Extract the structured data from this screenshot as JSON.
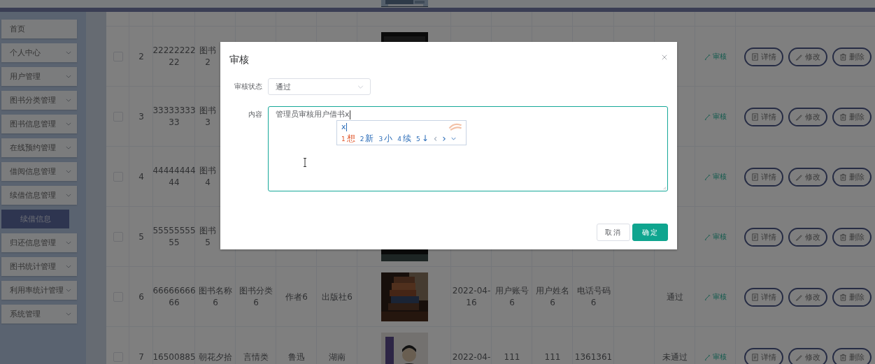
{
  "header": {
    "cover": {
      "kind": "picture"
    }
  },
  "sidebar": {
    "items": [
      {
        "label": "首页",
        "kind": "link",
        "selected": false
      },
      {
        "label": "个人中心",
        "kind": "submenu",
        "selected": false
      },
      {
        "label": "用户管理",
        "kind": "submenu",
        "selected": false
      },
      {
        "label": "图书分类管理",
        "kind": "submenu",
        "selected": false
      },
      {
        "label": "图书信息管理",
        "kind": "submenu",
        "selected": false
      },
      {
        "label": "在线预约管理",
        "kind": "submenu",
        "selected": false
      },
      {
        "label": "借阅信息管理",
        "kind": "submenu",
        "selected": false
      },
      {
        "label": "续借信息管理",
        "kind": "submenu",
        "selected": false,
        "children": [
          {
            "label": "续借信息",
            "selected": true
          }
        ]
      },
      {
        "label": "归还信息管理",
        "kind": "submenu",
        "selected": false
      },
      {
        "label": "图书统计管理",
        "kind": "submenu",
        "selected": false
      },
      {
        "label": "利用率统计管理",
        "kind": "submenu",
        "selected": false
      },
      {
        "label": "系统管理",
        "kind": "submenu",
        "selected": false
      }
    ]
  },
  "table": {
    "rows": [
      {
        "cells": [
          null,
          null,
          null,
          null,
          null,
          null,
          null,
          null,
          null,
          null,
          null,
          null,
          null
        ]
      },
      {
        "checked": false,
        "cells": [
          "2",
          "22222222\n22",
          "图书\n2",
          null,
          null,
          null,
          {
            "kind": "picture"
          },
          null,
          null,
          null,
          null,
          null,
          null
        ],
        "review_link": "审核",
        "actions": [
          {
            "kind": "detail",
            "label": "详情"
          },
          {
            "kind": "edit",
            "label": "修改"
          },
          {
            "kind": "delete",
            "label": "删除"
          }
        ]
      },
      {
        "checked": false,
        "cells": [
          "3",
          "33333333\n33",
          "图书\n3",
          null,
          null,
          null,
          null,
          null,
          null,
          null,
          null,
          null,
          null
        ],
        "review_link": "审核",
        "actions": [
          {
            "kind": "detail",
            "label": "详情"
          },
          {
            "kind": "edit",
            "label": "修改"
          },
          {
            "kind": "delete",
            "label": "删除"
          }
        ]
      },
      {
        "checked": false,
        "cells": [
          "4",
          "44444444\n44",
          "图书\n4",
          null,
          null,
          null,
          null,
          null,
          null,
          null,
          null,
          null,
          null
        ],
        "review_link": "审核",
        "actions": [
          {
            "kind": "detail",
            "label": "详情"
          },
          {
            "kind": "edit",
            "label": "修改"
          },
          {
            "kind": "delete",
            "label": "删除"
          }
        ]
      },
      {
        "checked": false,
        "cells": [
          "5",
          "55555555\n55",
          "图书\n5",
          null,
          null,
          null,
          {
            "kind": "picture"
          },
          null,
          null,
          null,
          null,
          null,
          null
        ],
        "review_link": "审核",
        "actions": [
          {
            "kind": "detail",
            "label": "详情"
          },
          {
            "kind": "edit",
            "label": "修改"
          },
          {
            "kind": "delete",
            "label": "删除"
          }
        ]
      },
      {
        "checked": false,
        "cells": [
          "6",
          "66666666\n66",
          "图书名称\n6",
          "图书分类\n6",
          "作者6",
          "出版社6",
          {
            "kind": "picture"
          },
          "2022-04-\n16",
          "用户账号\n6",
          "用户姓名\n6",
          "电话号码\n6",
          null,
          "通过"
        ],
        "review_link": "审核",
        "actions": [
          {
            "kind": "detail",
            "label": "详情"
          },
          {
            "kind": "edit",
            "label": "修改"
          },
          {
            "kind": "delete",
            "label": "删除"
          }
        ]
      },
      {
        "checked": false,
        "cells": [
          "7",
          "16500885",
          "朝花夕拾",
          "言情类",
          "鲁迅",
          "湖南",
          {
            "kind": "picture"
          },
          "2022-04-",
          "111",
          "111",
          "1361361",
          null,
          "未通过"
        ],
        "review_link": "审核",
        "actions": [
          {
            "kind": "detail",
            "label": "详情"
          },
          {
            "kind": "edit",
            "label": "修改"
          },
          {
            "kind": "delete",
            "label": "删除"
          }
        ]
      }
    ]
  },
  "dialog": {
    "title": "审核",
    "fields": [
      {
        "kind": "select",
        "label": "审核状态",
        "value": "通过"
      },
      {
        "kind": "textarea",
        "label": "内容",
        "value": "管理员审核用户借书x"
      }
    ],
    "ime": {
      "composition": "x",
      "candidates": [
        {
          "number": "1",
          "text": "想",
          "selected": true
        },
        {
          "number": "2",
          "text": "新",
          "selected": false
        },
        {
          "number": "3",
          "text": "小",
          "selected": false
        },
        {
          "number": "4",
          "text": "续",
          "selected": false
        },
        {
          "number": "5",
          "text": "↓",
          "selected": false
        }
      ],
      "prev": {
        "text": "‹",
        "disabled": true
      },
      "next": {
        "text": "›",
        "disabled": false
      }
    },
    "buttons": [
      {
        "kind": "secondary",
        "label": "取消"
      },
      {
        "kind": "primary",
        "label": "确定"
      }
    ]
  }
}
